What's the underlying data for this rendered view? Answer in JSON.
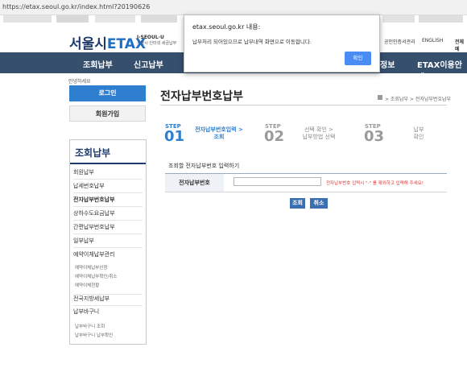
{
  "browser": {
    "url": "https://etax.seoul.go.kr/index.html?20190626"
  },
  "header": {
    "logo_text": "서울시",
    "logo_brand": "ETAX",
    "logo_sub1": "I·SEOUL·U",
    "logo_sub2": "서울시 인터넷 세금납부",
    "links": [
      "공인인증서관리",
      "ENGLISH",
      "전체메"
    ]
  },
  "nav": {
    "items": [
      "조회납부",
      "신고납부",
      "정보",
      "ETAX이용안내"
    ]
  },
  "sidebar": {
    "hello": "안녕하세요",
    "login": "로그인",
    "join": "회원가입",
    "title": "조회납부",
    "items": [
      "회원납부",
      "납세번호납부",
      "전자납부번호납부",
      "상하수도요금납부",
      "간편납부번호납부",
      "일부납부",
      "예약이체납부관리",
      "전국지방세납부",
      "납부바구니"
    ],
    "sub_reservation": [
      "예약이체납부신청",
      "예약이체납부확인/취소",
      "예약이체현황"
    ],
    "sub_basket": [
      "납부바구니 조회",
      "납부바구니 납부확인"
    ]
  },
  "main": {
    "title": "전자납부번호납부",
    "breadcrumb": "> 조회납부 > 전자납부번호납부",
    "steps": [
      {
        "label": "STEP",
        "num": "01",
        "text1": "전자납부번호입력 >",
        "text2": "조회",
        "color": "#2f7fd0"
      },
      {
        "label": "STEP",
        "num": "02",
        "text1": "선택 확인 >",
        "text2": "납부방법 선택",
        "color": "#9a9a9a"
      },
      {
        "label": "STEP",
        "num": "03",
        "text1": "납부",
        "text2": "확인",
        "color": "#9a9a9a"
      }
    ],
    "subheading": "조회할 전자납부번호 입력하기",
    "field_label": "전자납부번호",
    "field_value": "",
    "field_hint": "전자납부번호 입력시 \"-\" 를 제외하고 입력해 주세요!",
    "search_btn": "조회",
    "cancel_btn": "취소"
  },
  "dialog": {
    "title": "etax.seoul.go.kr 내용:",
    "message": "납부처리 되어있으므로 납부내역 화면으로 이동합니다.",
    "ok": "확인"
  }
}
